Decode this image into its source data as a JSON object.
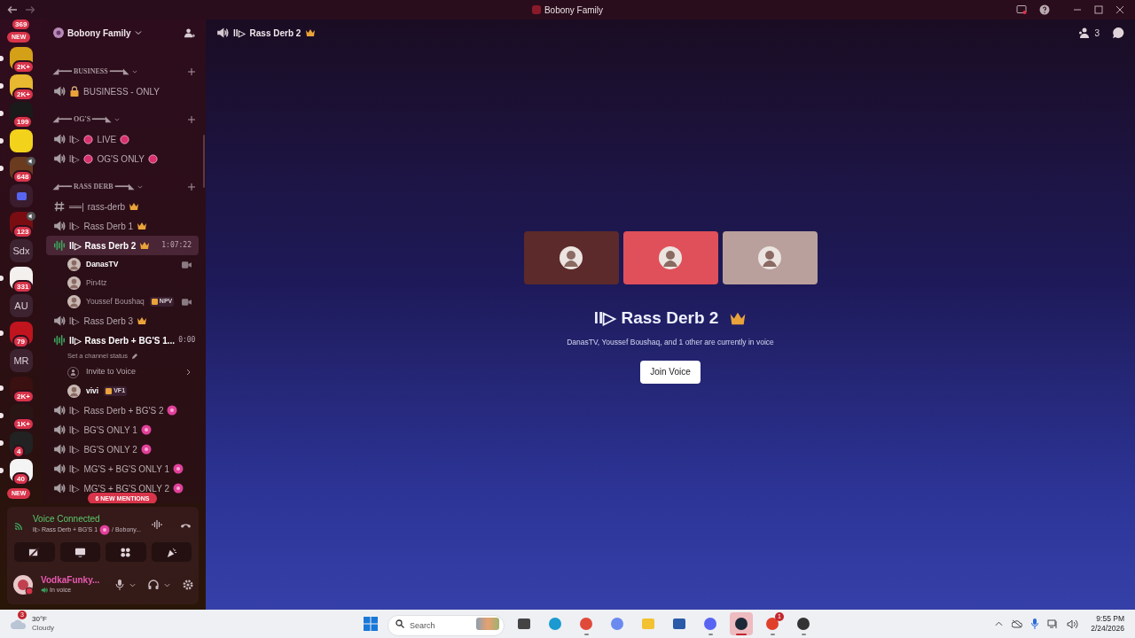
{
  "window": {
    "title": "Bobony Family"
  },
  "servers": [
    {
      "kind": "cut",
      "badge": "369"
    },
    {
      "kind": "image",
      "color": "#d4a017",
      "badge": "2K+",
      "unread": true,
      "speaker": false
    },
    {
      "kind": "image",
      "color": "#e8b830",
      "badge": "2K+",
      "unread": true,
      "speaker": false
    },
    {
      "kind": "image",
      "color": "#1a1a1a",
      "badge": "199",
      "unread": true,
      "speaker": false
    },
    {
      "kind": "image",
      "color": "#f2d21b",
      "unread": true,
      "speaker": false
    },
    {
      "kind": "image",
      "color": "#6b3b1f",
      "badge": "648",
      "unread": true,
      "speaker": true
    },
    {
      "kind": "folder",
      "color": "#5865f2",
      "unread": false,
      "speaker": false
    },
    {
      "kind": "image",
      "color": "#7a0d12",
      "badge": "123",
      "unread": false,
      "speaker": true
    },
    {
      "kind": "text",
      "label": "Sdx",
      "unread": false,
      "speaker": false
    },
    {
      "kind": "image",
      "color": "#f4f0ee",
      "badge": "331",
      "unread": true,
      "speaker": false
    },
    {
      "kind": "text",
      "label": "AU",
      "unread": false,
      "speaker": false
    },
    {
      "kind": "image",
      "color": "#c0141e",
      "badge": "79",
      "unread": true,
      "speaker": false
    },
    {
      "kind": "text",
      "label": "MR",
      "unread": false,
      "speaker": false
    },
    {
      "kind": "image",
      "color": "#3a1010",
      "badge": "2K+",
      "unread": true,
      "speaker": false
    },
    {
      "kind": "image",
      "color": "#2a1515",
      "badge": "1K+",
      "unread": true,
      "speaker": false
    },
    {
      "kind": "image",
      "color": "#222222",
      "badge": "4",
      "unread": true,
      "speaker": false
    },
    {
      "kind": "image",
      "color": "#f4f4f4",
      "badge": "40",
      "unread": true,
      "speaker": false
    }
  ],
  "server_pills": {
    "top": "NEW",
    "bottom": "NEW"
  },
  "sidebar_header": {
    "server_name": "Bobony Family"
  },
  "categories": [
    {
      "name": "◢━━━ BUSINESS ━━━◣",
      "channels": [
        {
          "kind": "voice",
          "name": "BUSINESS - ONLY",
          "lock": true,
          "dots": false,
          "crown": false,
          "flower": false,
          "selected": false
        }
      ]
    },
    {
      "name": "◢━━━ OG'S ━━━◣",
      "channels": [
        {
          "kind": "voice",
          "prefix": "ll▷",
          "name": "LIVE",
          "lock": false,
          "dots": true,
          "crown": false,
          "flower": false,
          "selected": false
        },
        {
          "kind": "voice",
          "prefix": "ll▷",
          "name": "OG'S ONLY",
          "lock": false,
          "dots": true,
          "crown": false,
          "flower": false,
          "selected": false
        }
      ]
    },
    {
      "name": "◢━━━ RASS DERB ━━━◣",
      "channels": [
        {
          "kind": "text",
          "prefix": "══|",
          "name": "rass-derb",
          "lock": false,
          "dots": false,
          "crown": true,
          "flower": false,
          "selected": false
        },
        {
          "kind": "voice",
          "prefix": "ll▷",
          "name": "Rass Derb 1",
          "lock": false,
          "dots": false,
          "crown": true,
          "flower": false,
          "selected": false
        },
        {
          "kind": "live",
          "prefix": "ll▷",
          "name": "Rass Derb 2",
          "lock": false,
          "dots": false,
          "crown": true,
          "flower": false,
          "selected": true,
          "time": "1:07:22",
          "users": [
            {
              "name": "DanasTV",
              "active": true,
              "camera": true
            },
            {
              "name": "Pin4tz",
              "active": false,
              "camera": false
            },
            {
              "name": "Youssef Boushaq",
              "active": false,
              "camera": true,
              "tag": "NPV"
            }
          ]
        },
        {
          "kind": "voice",
          "prefix": "ll▷",
          "name": "Rass Derb 3",
          "lock": false,
          "dots": false,
          "crown": true,
          "flower": false,
          "selected": false
        },
        {
          "kind": "live",
          "prefix": "ll▷",
          "name": "Rass Derb + BG'S 1...",
          "lock": false,
          "dots": false,
          "crown": false,
          "flower": false,
          "selected": false,
          "time": "0:00",
          "status": "Set a channel status",
          "invite": "Invite to Voice",
          "users": [
            {
              "name": "vivi",
              "active": true,
              "camera": false,
              "tag": "VF1"
            }
          ]
        },
        {
          "kind": "voice",
          "prefix": "ll▷",
          "name": "Rass Derb + BG'S 2",
          "lock": false,
          "dots": false,
          "crown": false,
          "flower": true,
          "selected": false
        },
        {
          "kind": "voice",
          "prefix": "ll▷",
          "name": "BG'S ONLY 1",
          "lock": false,
          "dots": false,
          "crown": false,
          "flower": true,
          "selected": false
        },
        {
          "kind": "voice",
          "prefix": "ll▷",
          "name": "BG'S ONLY 2",
          "lock": false,
          "dots": false,
          "crown": false,
          "flower": true,
          "selected": false
        },
        {
          "kind": "voice",
          "prefix": "ll▷",
          "name": "MG'S + BG'S ONLY 1",
          "lock": false,
          "dots": false,
          "crown": false,
          "flower": true,
          "selected": false
        },
        {
          "kind": "voice",
          "prefix": "ll▷",
          "name": "MG'S + BG'S ONLY 2",
          "lock": false,
          "dots": false,
          "crown": false,
          "flower": true,
          "selected": false
        }
      ]
    }
  ],
  "mentions_pill": "6 NEW MENTIONS",
  "voice_panel": {
    "status": "Voice Connected",
    "channel": "ll▷ Rass Derb + BG'S 1",
    "server": "/ Bobony..."
  },
  "user": {
    "name": "VodkaFunky...",
    "status": "In voice"
  },
  "header": {
    "prefix": "ll▷",
    "name": "Rass Derb 2",
    "member_count": "3"
  },
  "call": {
    "tiles": [
      {
        "color": "#5c2a2a"
      },
      {
        "color": "#e0505a"
      },
      {
        "color": "#b9a09c"
      }
    ],
    "title": "ll▷ Rass Derb 2",
    "subtitle": "DanasTV, Youssef Boushaq, and 1 other are currently in voice",
    "join": "Join Voice"
  },
  "taskbar": {
    "weather": {
      "temp": "30°F",
      "desc": "Cloudy",
      "badge": "3"
    },
    "search": {
      "placeholder": "Search"
    },
    "apps": [
      {
        "kind": "taskview",
        "running": false,
        "selected": false
      },
      {
        "kind": "edge",
        "running": false,
        "selected": false
      },
      {
        "kind": "chrome",
        "running": true,
        "selected": false
      },
      {
        "kind": "copilot",
        "running": false,
        "selected": false
      },
      {
        "kind": "files",
        "running": false,
        "selected": false
      },
      {
        "kind": "store",
        "running": false,
        "selected": false
      },
      {
        "kind": "discord",
        "running": true,
        "selected": false
      },
      {
        "kind": "steam",
        "running": true,
        "selected": true
      },
      {
        "kind": "ea",
        "running": true,
        "selected": false,
        "badge": "1"
      },
      {
        "kind": "obs",
        "running": true,
        "selected": false
      }
    ],
    "time": "9:55 PM",
    "date": "2/24/2026"
  }
}
